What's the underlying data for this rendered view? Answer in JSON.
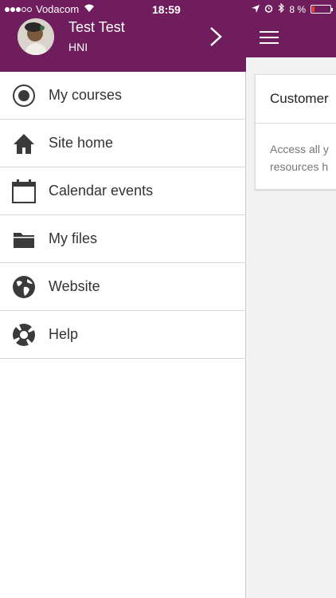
{
  "status_bar": {
    "carrier": "Vodacom",
    "time": "18:59",
    "battery": "8 %"
  },
  "drawer": {
    "user": {
      "name": "Test Test",
      "subtitle": "HNI"
    },
    "items": [
      {
        "label": "My courses",
        "icon": "courses-icon"
      },
      {
        "label": "Site home",
        "icon": "home-icon"
      },
      {
        "label": "Calendar events",
        "icon": "calendar-icon"
      },
      {
        "label": "My files",
        "icon": "folder-icon"
      },
      {
        "label": "Website",
        "icon": "globe-icon"
      },
      {
        "label": "Help",
        "icon": "lifebuoy-icon"
      }
    ]
  },
  "main": {
    "card_title": "Customer",
    "card_body": "Access all y resources h"
  },
  "colors": {
    "brand": "#6f1d5c",
    "battery_low": "#ff3b30"
  }
}
